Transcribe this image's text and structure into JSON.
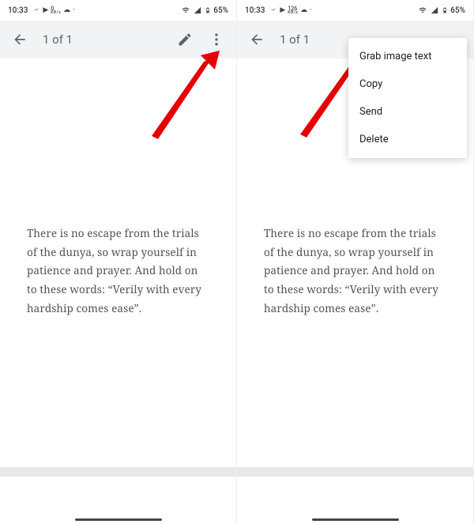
{
  "status": {
    "time": "10:33",
    "kbps_value": "0",
    "kbps_value2": "126",
    "kbps_label": "KB/s",
    "battery": "65%"
  },
  "toolbar": {
    "page_counter": "1 of 1"
  },
  "content": {
    "body": "There is no escape from the trials of the dunya, so wrap yourself in patience and prayer. And hold on to these words: “Verily with every hardship comes ease”."
  },
  "menu": {
    "items": [
      "Grab image text",
      "Copy",
      "Send",
      "Delete"
    ]
  }
}
